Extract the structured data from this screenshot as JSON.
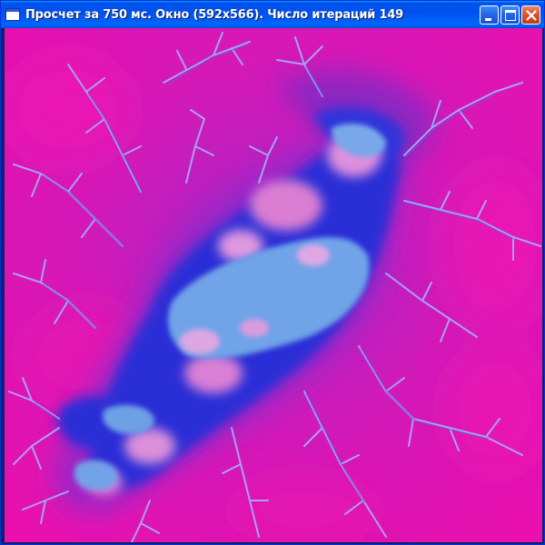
{
  "window": {
    "title": "Просчет за 750 мс. Окно (592x566). Число итераций 149",
    "icon": "window-app-icon",
    "controls": {
      "minimize": "minimize-icon",
      "maximize": "maximize-icon",
      "close": "close-icon"
    }
  },
  "fractal": {
    "type": "julia-set",
    "render_time_ms": 750,
    "window_size": "592x566",
    "iterations": 149,
    "colors": {
      "outer": "#e011b0",
      "mid": "#f070c8",
      "deep_blue": "#1e28d0",
      "filament": "#9aa2f0",
      "interior": "#6fa3e8",
      "highlight": "#f6a0dc"
    }
  }
}
